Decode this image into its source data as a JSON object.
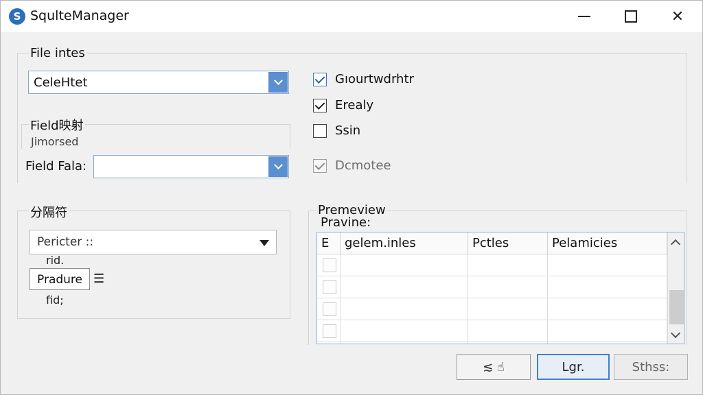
{
  "window": {
    "title": "SqulteManager",
    "app_icon_glyph": "S",
    "controls": [
      "minimize-icon",
      "maximize-icon",
      "close-icon"
    ]
  },
  "file_section": {
    "label": "File intes",
    "combo_value": "CeleHtet"
  },
  "options": [
    {
      "label": "Gıourtwdrhtr",
      "checked": true,
      "disabled": false
    },
    {
      "label": "Erealy",
      "checked": true,
      "disabled": false
    },
    {
      "label": "Ssin",
      "checked": false,
      "disabled": false
    },
    {
      "label": "Dcmotee",
      "checked": true,
      "disabled": true
    }
  ],
  "field_mapping": {
    "label": "Field映射",
    "sublabel": "Jimorsed",
    "field_label": "Field Fala:",
    "field_value": ""
  },
  "delimiter": {
    "label": "分隔符",
    "combo_value": "Pericter ::",
    "note1": "rid.",
    "input_value": "Pradure",
    "menu_glyph": "☰",
    "note2": "fid;"
  },
  "preview": {
    "label": "Premeview",
    "sublabel": "Pravine:",
    "columns": [
      "E",
      "gelem.inles",
      "Pctles",
      "Pelamicies"
    ],
    "row_count": 5
  },
  "buttons": {
    "left_glyphs": "≲ ☝",
    "ok_label": "Lgr.",
    "right_label": "Sthss:"
  }
}
